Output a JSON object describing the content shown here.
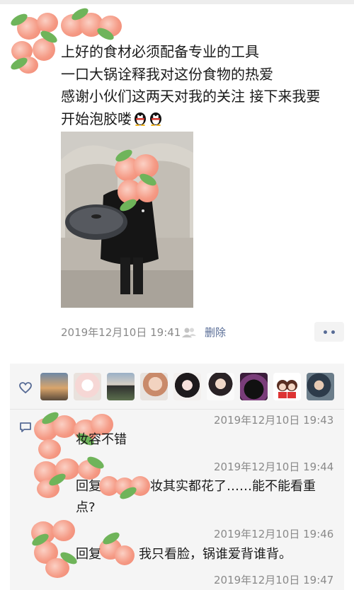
{
  "post": {
    "lines": [
      "上好的食材必须配备专业的工具",
      "一口大锅诠释我对这份食物的热爱",
      "感谢小伙们这两天对我的关注 接下来我要",
      "开始泡胶喽"
    ],
    "emoji": [
      "penguin-emoji",
      "penguin-emoji"
    ],
    "timestamp": "2019年12月10日 19:41",
    "delete_label": "删除"
  },
  "likes": {
    "icon": "heart-icon",
    "avatars": [
      "avatar-1",
      "avatar-2",
      "avatar-3",
      "avatar-4",
      "avatar-5",
      "avatar-6",
      "avatar-7",
      "avatar-8",
      "avatar-9"
    ]
  },
  "comments": [
    {
      "time": "2019年12月10日 19:43",
      "text": "妆容不错"
    },
    {
      "time": "2019年12月10日 19:44",
      "prefix": "回复",
      "text_a": "妆其实都花了……能不能看重",
      "text_b": "点?"
    },
    {
      "time": "2019年12月10日 19:46",
      "prefix": "回复",
      "text": "我只看脸，锅谁爱背谁背。"
    },
    {
      "time": "2019年12月10日 19:47"
    }
  ],
  "colors": {
    "link": "#576b95",
    "meta": "#8a8a8a",
    "panel": "#f5f5f5",
    "peach": "#f59b86",
    "leaf": "#6fb45a"
  }
}
